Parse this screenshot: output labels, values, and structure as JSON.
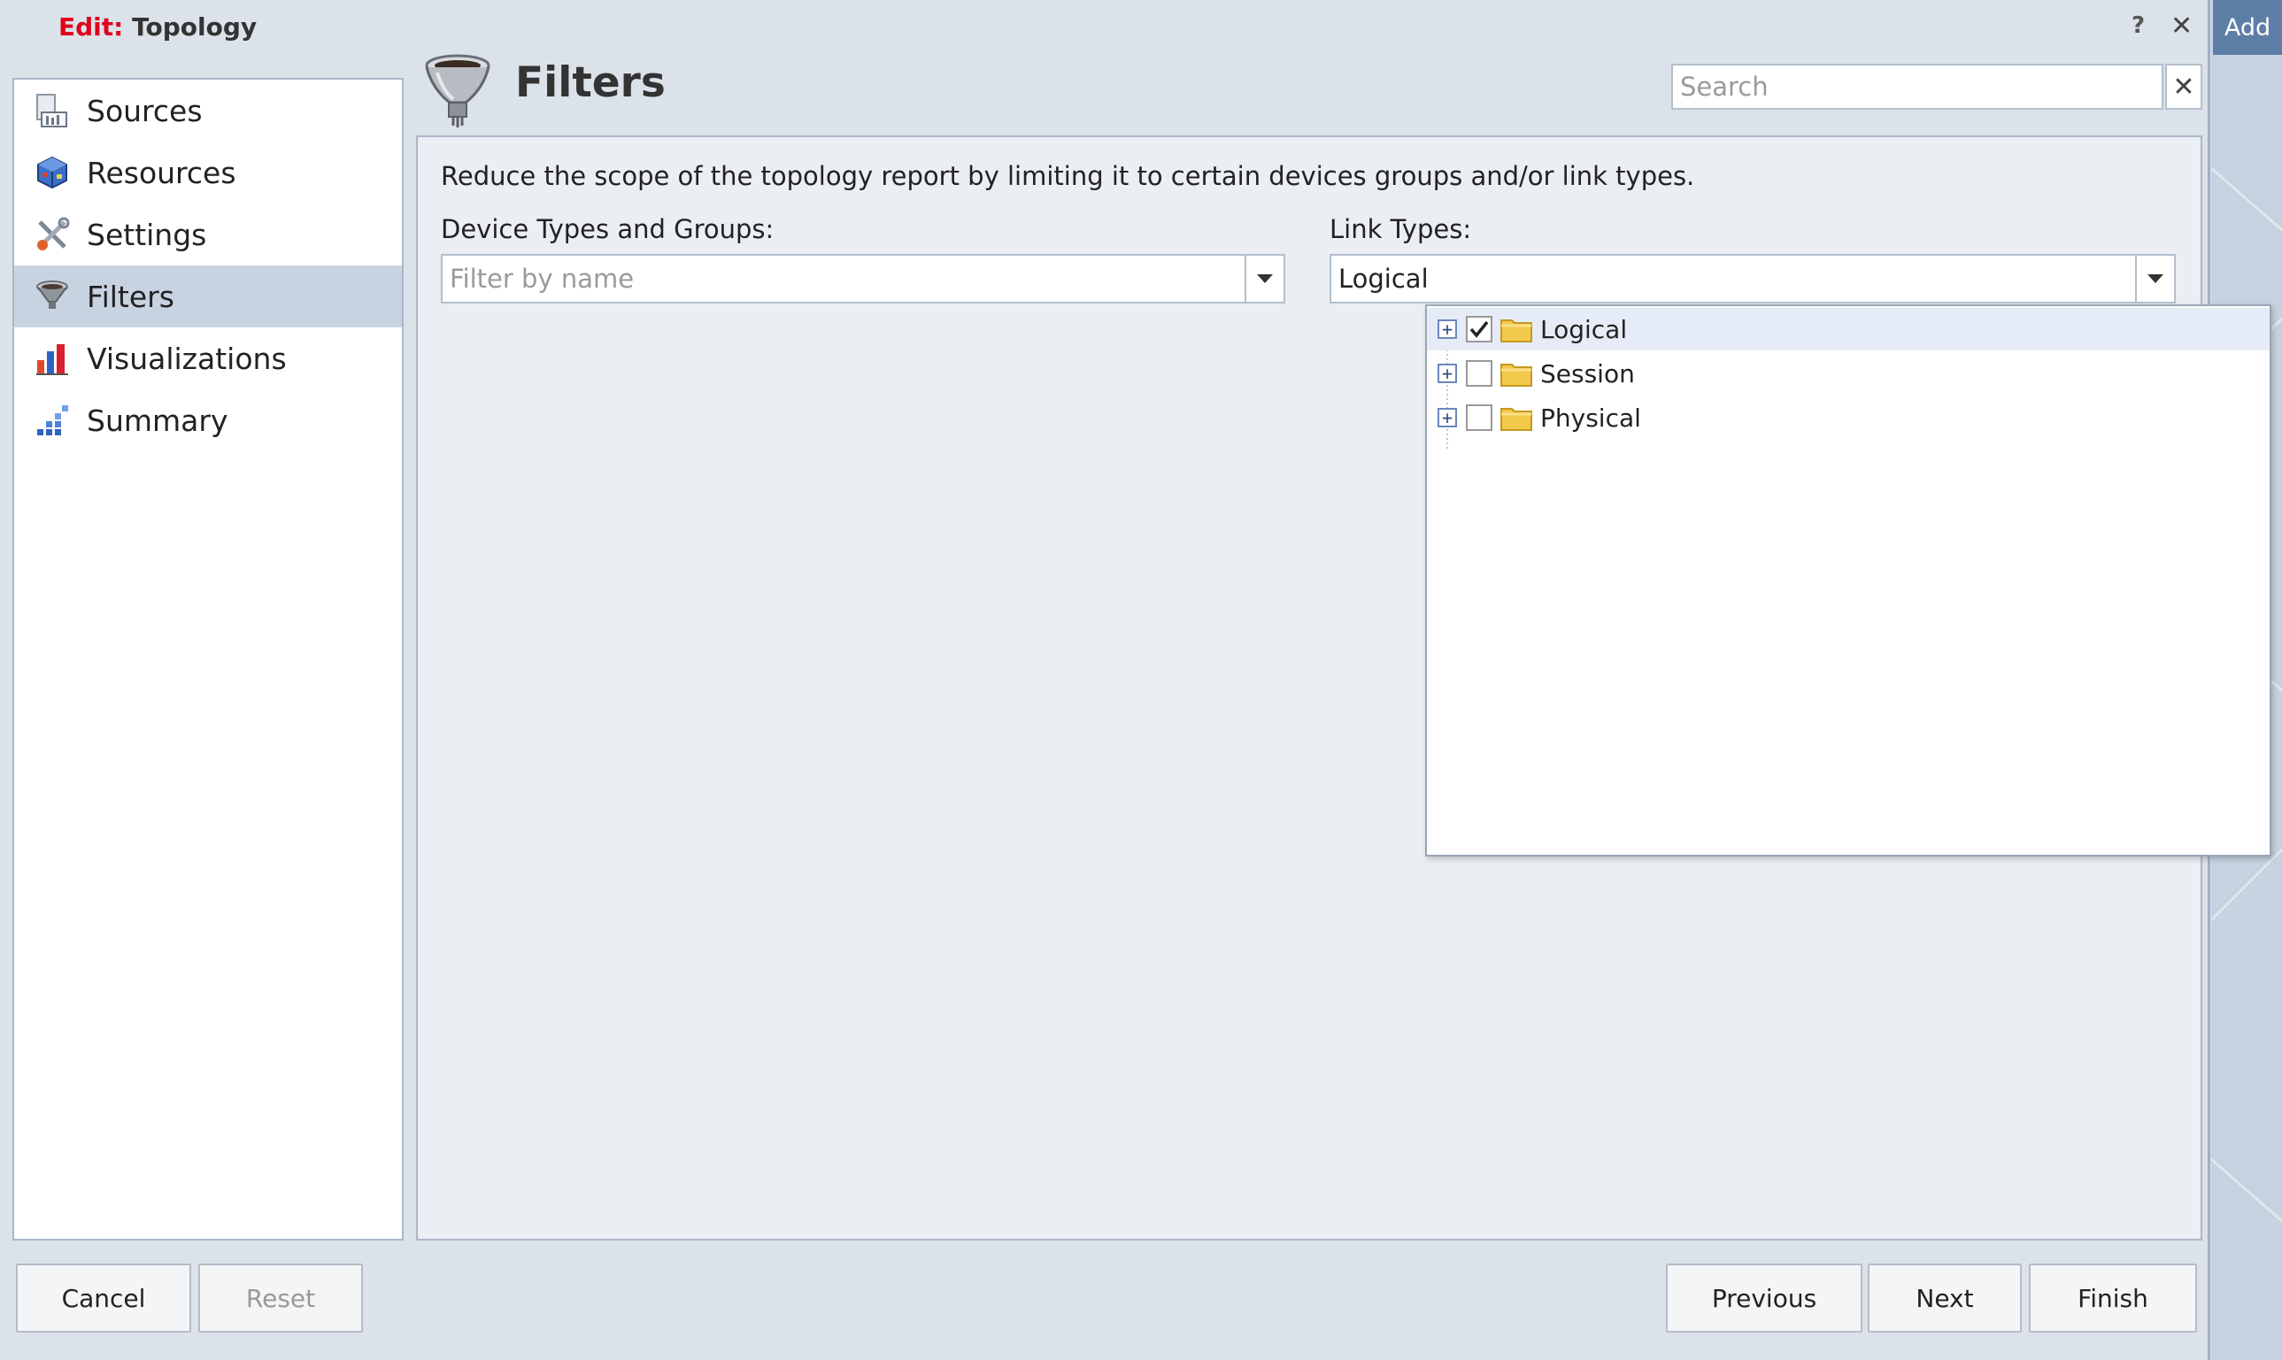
{
  "window": {
    "title_prefix": "Edit:",
    "title": "Topology",
    "help_glyph": "?",
    "close_glyph": "✕",
    "add_tab_label": "Add"
  },
  "sidebar": {
    "items": [
      {
        "label": "Sources",
        "icon": "sources-icon"
      },
      {
        "label": "Resources",
        "icon": "resources-icon"
      },
      {
        "label": "Settings",
        "icon": "settings-icon"
      },
      {
        "label": "Filters",
        "icon": "filters-icon",
        "active": true
      },
      {
        "label": "Visualizations",
        "icon": "visualizations-icon"
      },
      {
        "label": "Summary",
        "icon": "summary-icon"
      }
    ]
  },
  "header": {
    "title": "Filters",
    "icon": "funnel-icon",
    "search_placeholder": "Search",
    "search_clear_glyph": "✕"
  },
  "main": {
    "description": "Reduce the scope of the topology report by limiting it to certain devices groups and/or link types.",
    "device_types": {
      "label": "Device Types and Groups:",
      "placeholder": "Filter by name",
      "value": ""
    },
    "link_types": {
      "label": "Link Types:",
      "value": "Logical",
      "options": [
        {
          "label": "Logical",
          "checked": true,
          "selected": true
        },
        {
          "label": "Session",
          "checked": false
        },
        {
          "label": "Physical",
          "checked": false
        }
      ]
    }
  },
  "footer": {
    "cancel_label": "Cancel",
    "reset_label": "Reset",
    "previous_label": "Previous",
    "next_label": "Next",
    "finish_label": "Finish"
  },
  "colors": {
    "title_accent": "#e0001b",
    "active_nav_bg": "#c8d3e1",
    "add_tab_bg": "#5d7ea6"
  }
}
